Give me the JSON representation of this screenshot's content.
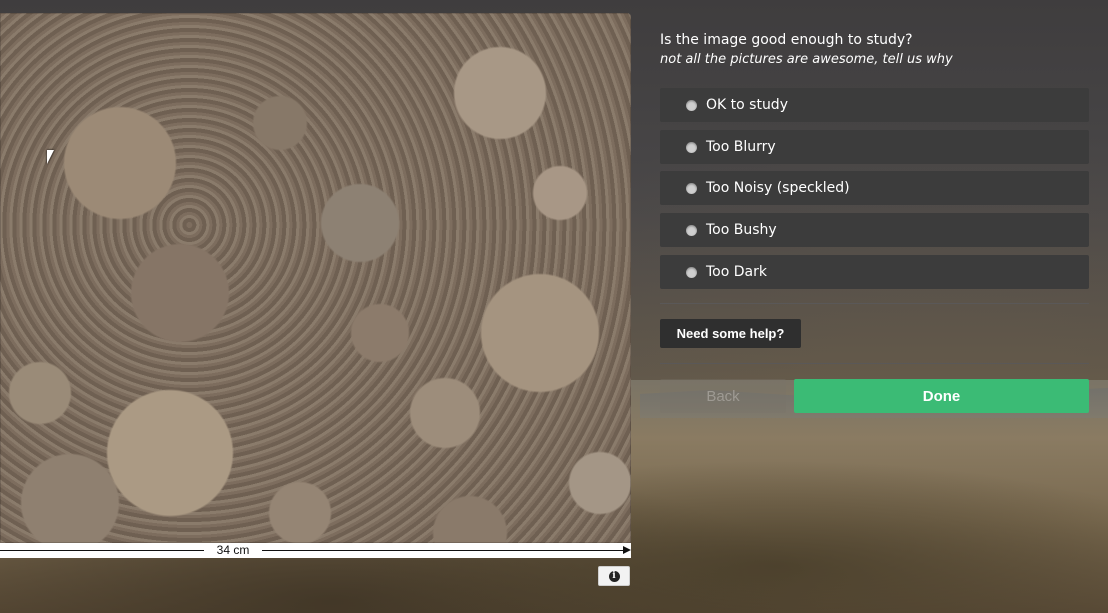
{
  "image_panel": {
    "scale_label": "34 cm",
    "info_icon": "info-icon"
  },
  "task": {
    "question": "Is the image good enough to study?",
    "instruction": "not all the pictures are awesome, tell us why",
    "options": [
      {
        "label": "OK to study"
      },
      {
        "label": "Too Blurry"
      },
      {
        "label": "Too Noisy (speckled)"
      },
      {
        "label": "Too Bushy"
      },
      {
        "label": "Too Dark"
      }
    ],
    "help_label": "Need some help?",
    "back_label": "Back",
    "done_label": "Done"
  },
  "colors": {
    "done_button": "#3bbb75",
    "option_background": "#3c3c3c",
    "help_button": "#2f2f2f"
  }
}
